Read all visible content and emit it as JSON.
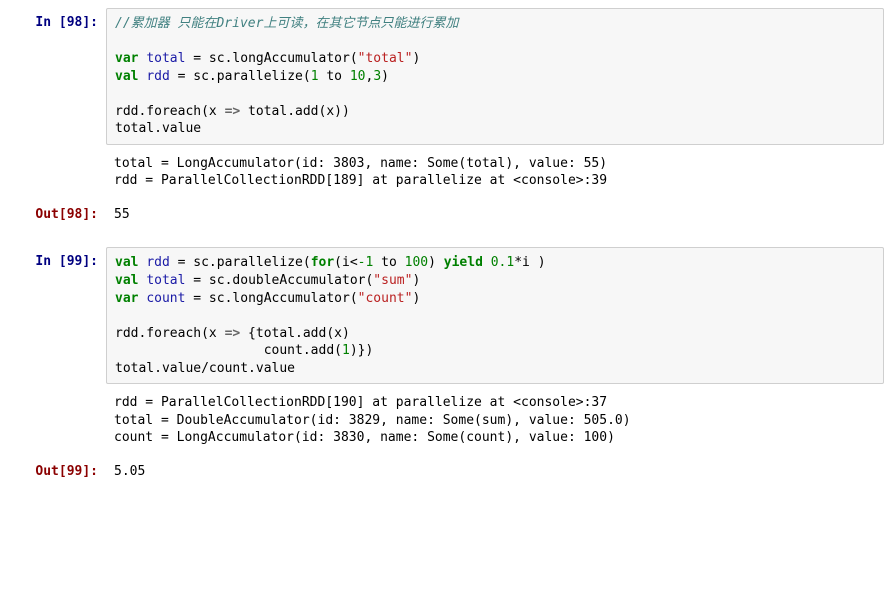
{
  "cells": [
    {
      "kind": "in",
      "prompt_prefix": "In [",
      "exec_count": "98",
      "prompt_suffix": "]:",
      "tokens": [
        {
          "t": "//累加器 只能在Driver上可读，在其它节点只能进行累加",
          "cls": "c-comment"
        },
        {
          "t": "\n\n"
        },
        {
          "t": "var",
          "cls": "c-kw"
        },
        {
          "t": " "
        },
        {
          "t": "total",
          "cls": "c-var"
        },
        {
          "t": " = sc.longAccumulator("
        },
        {
          "t": "\"total\"",
          "cls": "c-str"
        },
        {
          "t": ")"
        },
        {
          "t": "\n"
        },
        {
          "t": "val",
          "cls": "c-kw"
        },
        {
          "t": " "
        },
        {
          "t": "rdd",
          "cls": "c-var"
        },
        {
          "t": " = sc.parallelize("
        },
        {
          "t": "1",
          "cls": "c-num"
        },
        {
          "t": " to "
        },
        {
          "t": "10",
          "cls": "c-num"
        },
        {
          "t": ","
        },
        {
          "t": "3",
          "cls": "c-num"
        },
        {
          "t": ")"
        },
        {
          "t": "\n\n"
        },
        {
          "t": "rdd.foreach(x "
        },
        {
          "t": "=>",
          "cls": "c-op"
        },
        {
          "t": " total.add(x))"
        },
        {
          "t": "\n"
        },
        {
          "t": "total.value"
        }
      ]
    },
    {
      "kind": "stream",
      "text": "total = LongAccumulator(id: 3803, name: Some(total), value: 55)\nrdd = ParallelCollectionRDD[189] at parallelize at <console>:39"
    },
    {
      "kind": "out",
      "prompt_prefix": "Out[",
      "exec_count": "98",
      "prompt_suffix": "]:",
      "text": "55"
    },
    {
      "kind": "in",
      "prompt_prefix": "In [",
      "exec_count": "99",
      "prompt_suffix": "]:",
      "tokens": [
        {
          "t": "val",
          "cls": "c-kw"
        },
        {
          "t": " "
        },
        {
          "t": "rdd",
          "cls": "c-var"
        },
        {
          "t": " = sc.parallelize("
        },
        {
          "t": "for",
          "cls": "c-kw"
        },
        {
          "t": "(i<"
        },
        {
          "t": "-1",
          "cls": "c-num"
        },
        {
          "t": " to "
        },
        {
          "t": "100",
          "cls": "c-num"
        },
        {
          "t": ") "
        },
        {
          "t": "yield",
          "cls": "c-kw"
        },
        {
          "t": " "
        },
        {
          "t": "0.1",
          "cls": "c-num"
        },
        {
          "t": "*i )"
        },
        {
          "t": "\n"
        },
        {
          "t": "val",
          "cls": "c-kw"
        },
        {
          "t": " "
        },
        {
          "t": "total",
          "cls": "c-var"
        },
        {
          "t": " = sc.doubleAccumulator("
        },
        {
          "t": "\"sum\"",
          "cls": "c-str"
        },
        {
          "t": ")"
        },
        {
          "t": "\n"
        },
        {
          "t": "var",
          "cls": "c-kw"
        },
        {
          "t": " "
        },
        {
          "t": "count",
          "cls": "c-var"
        },
        {
          "t": " = sc.longAccumulator("
        },
        {
          "t": "\"count\"",
          "cls": "c-str"
        },
        {
          "t": ")"
        },
        {
          "t": "\n\n"
        },
        {
          "t": "rdd.foreach(x "
        },
        {
          "t": "=>",
          "cls": "c-op"
        },
        {
          "t": " {total.add(x)"
        },
        {
          "t": "\n"
        },
        {
          "t": "                   count.add("
        },
        {
          "t": "1",
          "cls": "c-num"
        },
        {
          "t": ")})"
        },
        {
          "t": "\n"
        },
        {
          "t": "total.value/count.value"
        }
      ]
    },
    {
      "kind": "stream",
      "text": "rdd = ParallelCollectionRDD[190] at parallelize at <console>:37\ntotal = DoubleAccumulator(id: 3829, name: Some(sum), value: 505.0)\ncount = LongAccumulator(id: 3830, name: Some(count), value: 100)"
    },
    {
      "kind": "out",
      "prompt_prefix": "Out[",
      "exec_count": "99",
      "prompt_suffix": "]:",
      "text": "5.05"
    }
  ]
}
